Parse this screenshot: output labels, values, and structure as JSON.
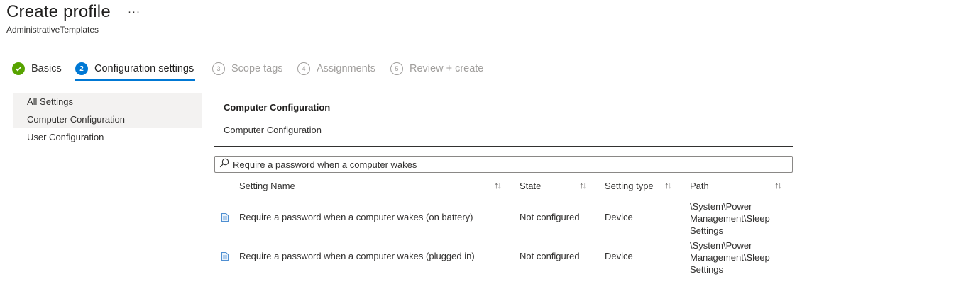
{
  "header": {
    "title": "Create profile",
    "more": "···",
    "subtitle": "AdministrativeTemplates"
  },
  "steps": [
    {
      "number": "",
      "label": "Basics",
      "status": "completed"
    },
    {
      "number": "2",
      "label": "Configuration settings",
      "status": "current"
    },
    {
      "number": "3",
      "label": "Scope tags",
      "status": "upcoming"
    },
    {
      "number": "4",
      "label": "Assignments",
      "status": "upcoming"
    },
    {
      "number": "5",
      "label": "Review + create",
      "status": "upcoming"
    }
  ],
  "sidebar": {
    "items": [
      {
        "label": "All Settings"
      },
      {
        "label": "Computer Configuration",
        "selected": true
      },
      {
        "label": "User Configuration"
      }
    ]
  },
  "main": {
    "section_title": "Computer Configuration",
    "section_subtitle": "Computer Configuration",
    "search": {
      "value": "Require a password when a computer wakes",
      "placeholder": ""
    },
    "table": {
      "columns": [
        "Setting Name",
        "State",
        "Setting type",
        "Path"
      ],
      "sort_glyph_up": "↑",
      "sort_glyph_down": "↓",
      "rows": [
        {
          "name": "Require a password when a computer wakes (on battery)",
          "state": "Not configured",
          "type": "Device",
          "path_lines": [
            "\\System\\Power",
            "Management\\Sleep",
            "Settings"
          ]
        },
        {
          "name": "Require a password when a computer wakes (plugged in)",
          "state": "Not configured",
          "type": "Device",
          "path_lines": [
            "\\System\\Power",
            "Management\\Sleep",
            "Settings"
          ]
        }
      ]
    }
  },
  "colors": {
    "accent": "#0078d4",
    "success": "#57a300",
    "disabled": "#a19f9d"
  },
  "icons": {
    "completed_step": "checkmark-icon",
    "row_icon": "document-icon",
    "search": "search-icon",
    "more": "more-icon"
  }
}
